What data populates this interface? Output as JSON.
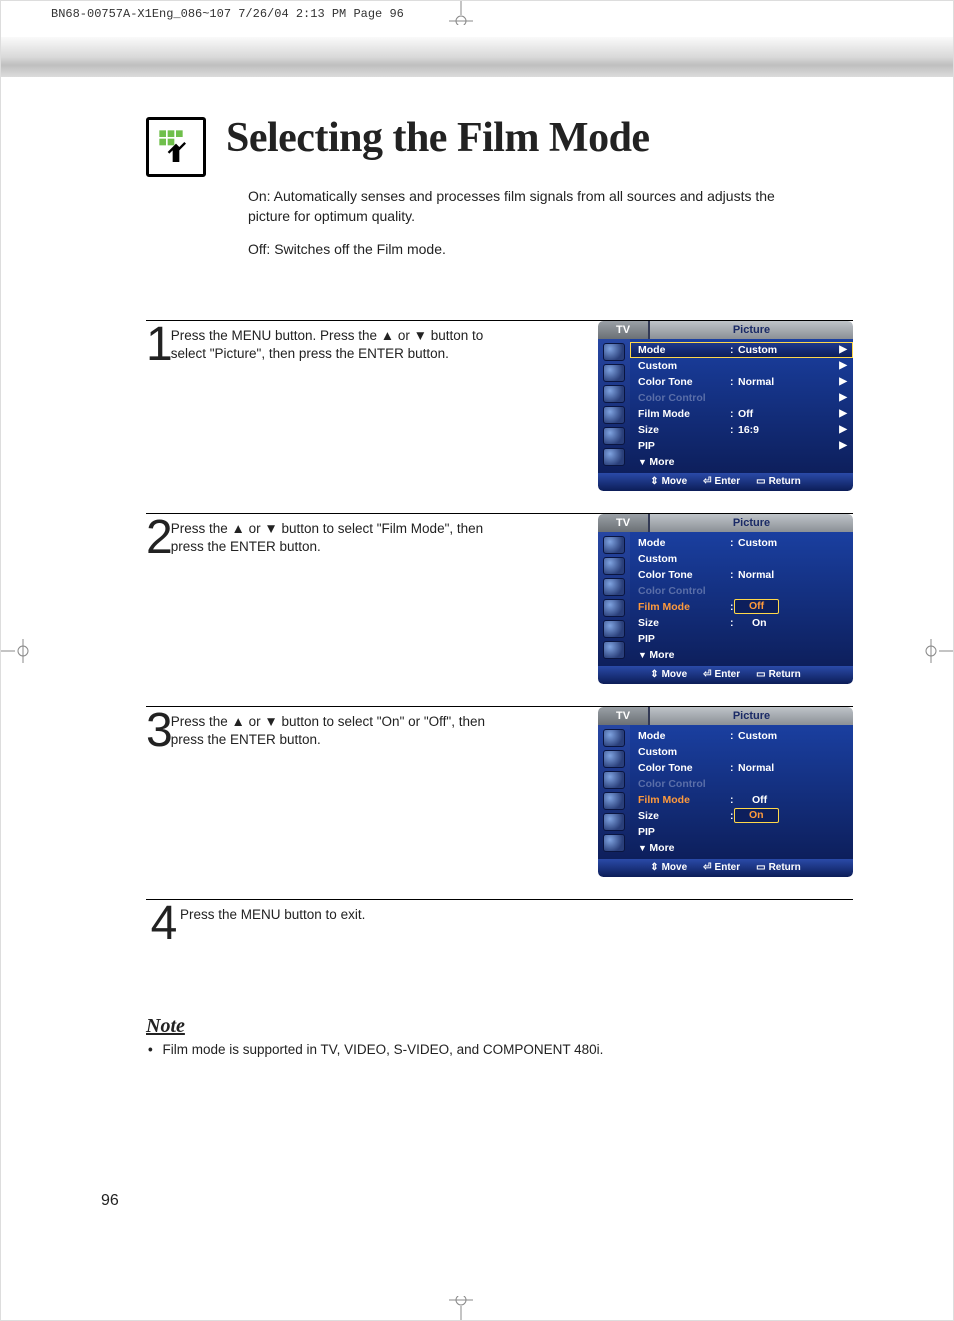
{
  "print_header": "BN68-00757A-X1Eng_086~107  7/26/04  2:13 PM  Page 96",
  "title": "Selecting the Film Mode",
  "intro": {
    "p1": "On: Automatically senses and processes film signals from all sources and adjusts the picture for optimum quality.",
    "p2": "Off: Switches off the Film mode."
  },
  "steps": [
    {
      "num": "1",
      "text": "Press the MENU button. Press the ▲ or ▼ button to select \"Picture\", then press the ENTER button."
    },
    {
      "num": "2",
      "text": "Press the ▲ or ▼ button to select \"Film Mode\", then press the ENTER button."
    },
    {
      "num": "3",
      "text": "Press the ▲ or ▼ button to select \"On\" or \"Off\", then press the ENTER button."
    },
    {
      "num": "4",
      "text": "Press the MENU button to exit."
    }
  ],
  "osd": {
    "tv": "TV",
    "title": "Picture",
    "footer": {
      "move": "Move",
      "enter": "Enter",
      "return": "Return"
    },
    "more": "More",
    "screen1": {
      "rows": [
        {
          "label": "Mode",
          "value": "Custom",
          "arrow": true,
          "selected": true
        },
        {
          "label": "Custom",
          "value": "",
          "arrow": true
        },
        {
          "label": "Color Tone",
          "value": "Normal",
          "arrow": true
        },
        {
          "label": "Color Control",
          "value": "",
          "arrow": true,
          "dim": true
        },
        {
          "label": "Film Mode",
          "value": "Off",
          "arrow": true
        },
        {
          "label": "Size",
          "value": "16:9",
          "arrow": true
        },
        {
          "label": "PIP",
          "value": "",
          "arrow": true
        }
      ]
    },
    "screen2": {
      "rows": [
        {
          "label": "Mode",
          "value": "Custom"
        },
        {
          "label": "Custom",
          "value": ""
        },
        {
          "label": "Color Tone",
          "value": "Normal"
        },
        {
          "label": "Color Control",
          "value": "",
          "dim": true
        },
        {
          "label": "Film Mode",
          "value": "",
          "hl": true,
          "opts": {
            "sel": "Off",
            "other": "On"
          }
        },
        {
          "label": "Size",
          "value": ""
        },
        {
          "label": "PIP",
          "value": ""
        }
      ]
    },
    "screen3": {
      "rows": [
        {
          "label": "Mode",
          "value": "Custom"
        },
        {
          "label": "Custom",
          "value": ""
        },
        {
          "label": "Color Tone",
          "value": "Normal"
        },
        {
          "label": "Color Control",
          "value": "",
          "dim": true
        },
        {
          "label": "Film Mode",
          "value": "",
          "hl": true,
          "opts": {
            "other": "Off",
            "sel": "On"
          }
        },
        {
          "label": "Size",
          "value": ""
        },
        {
          "label": "PIP",
          "value": ""
        }
      ]
    }
  },
  "note": {
    "heading": "Note",
    "item": "Film mode is supported in TV, VIDEO, S-VIDEO, and COMPONENT 480i."
  },
  "page_number": "96"
}
